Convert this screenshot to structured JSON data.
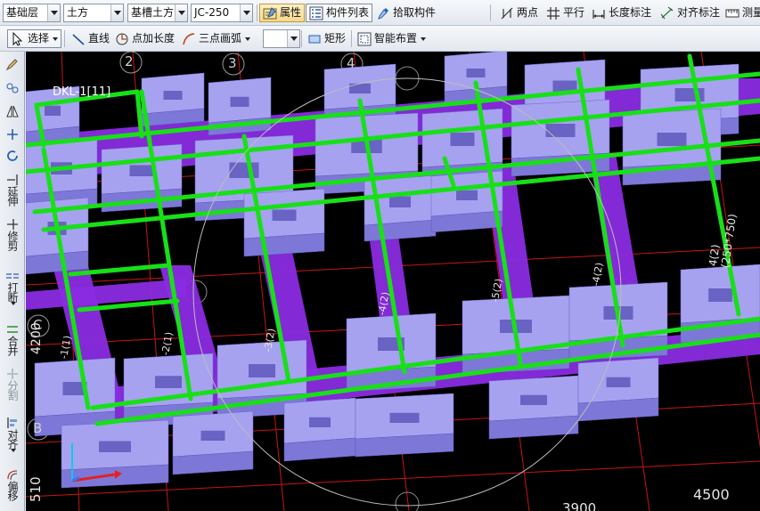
{
  "toolbar1": {
    "floor": "基础层",
    "category": "土方",
    "component_type": "基槽土方",
    "component_name": "JC-250",
    "properties_label": "属性",
    "component_list_label": "构件列表",
    "pick_component_label": "拾取构件",
    "two_point_label": "两点",
    "parallel_label": "平行",
    "length_dim_label": "长度标注",
    "align_dim_label": "对齐标注",
    "measure_label": "测量"
  },
  "toolbar2": {
    "select_label": "选择",
    "line_label": "直线",
    "point_length_label": "点加长度",
    "three_point_arc_label": "三点画弧",
    "rect_label": "矩形",
    "smart_layout_label": "智能布置"
  },
  "sidebar": {
    "extend_label": "延伸",
    "trim_label": "修剪",
    "break_label": "打断",
    "merge_label": "合并",
    "split_label": "分割",
    "align_label": "对齐",
    "offset_label": "偏移"
  },
  "viewport": {
    "axis_top": [
      "2",
      "3",
      "4"
    ],
    "axis_left": [
      "C",
      "B"
    ],
    "beam_label": "DKL-1[11]",
    "beam_labels": [
      "-1(1)",
      "-2(1)",
      "-3(2)",
      "-4(2)",
      "-5(2)",
      "-4(2)",
      "4(2)(250*750)"
    ],
    "dim_left_1": "4200",
    "dim_left_2": "510",
    "dim_bottom_1": "3900",
    "dim_bottom_2": "4500"
  },
  "colors": {
    "background": "#000000",
    "beam": "#17e017",
    "foundation_top": "#a6a2f0",
    "foundation_side": "#7d78d8",
    "trench": "#8a2be2",
    "grid": "#c81414"
  }
}
